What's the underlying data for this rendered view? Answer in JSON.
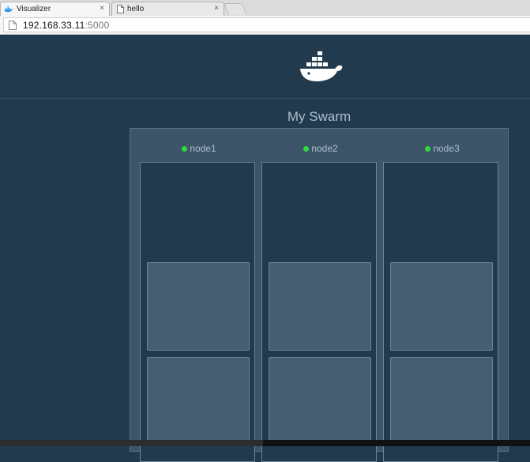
{
  "browser": {
    "tabs": [
      {
        "label": "Visualizer",
        "icon": "docker-whale-icon",
        "close": "×",
        "active": true
      },
      {
        "label": "hello",
        "icon": "page-icon",
        "close": "×",
        "active": false
      }
    ],
    "address": {
      "host": "192.168.33.11",
      "port": ":5000"
    }
  },
  "page": {
    "logo": "docker-whale-icon",
    "title": "My Swarm",
    "colors": {
      "background": "#213a4e",
      "cluster": "#3d5569",
      "status_dot": "#2fdc3a",
      "whale": "#ffffff"
    },
    "nodes": [
      {
        "name": "node1",
        "status": "up",
        "tasks": 2
      },
      {
        "name": "node2",
        "status": "up",
        "tasks": 2
      },
      {
        "name": "node3",
        "status": "up",
        "tasks": 2
      }
    ]
  }
}
